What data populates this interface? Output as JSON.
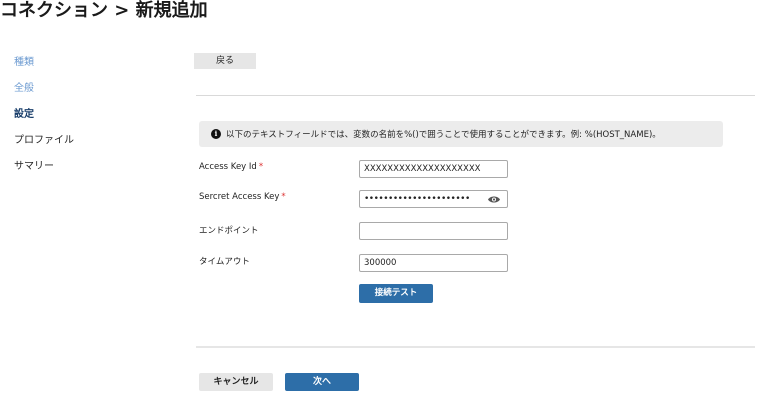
{
  "page": {
    "title": "コネクション > 新規追加"
  },
  "steps": [
    {
      "label": "種類",
      "state": "done"
    },
    {
      "label": "全般",
      "state": "done"
    },
    {
      "label": "設定",
      "state": "current"
    },
    {
      "label": "プロファイル",
      "state": "todo"
    },
    {
      "label": "サマリー",
      "state": "todo"
    }
  ],
  "toolbar": {
    "back_label": "戻る"
  },
  "info": {
    "icon": "info-icon",
    "text": "以下のテキストフィールドでは、変数の名前を%()で囲うことで使用することができます。例: %(HOST_NAME)。"
  },
  "form": {
    "access_key_id": {
      "label": "Access Key Id",
      "required_mark": "*",
      "value": "XXXXXXXXXXXXXXXXXXXX"
    },
    "secret_access_key": {
      "label": "Sercret Access Key",
      "required_mark": "*",
      "value": "••••••••••••••••••••••",
      "icon": "eye-icon"
    },
    "endpoint": {
      "label": "エンドポイント",
      "value": ""
    },
    "timeout": {
      "label": "タイムアウト",
      "value": "300000"
    },
    "test_button_label": "接続テスト"
  },
  "footer": {
    "cancel_label": "キャンセル",
    "next_label": "次へ"
  },
  "colors": {
    "primary": "#2d6ea8",
    "step_done": "#6d9bd1",
    "step_current": "#1a3f6b",
    "required": "#dd3333"
  }
}
